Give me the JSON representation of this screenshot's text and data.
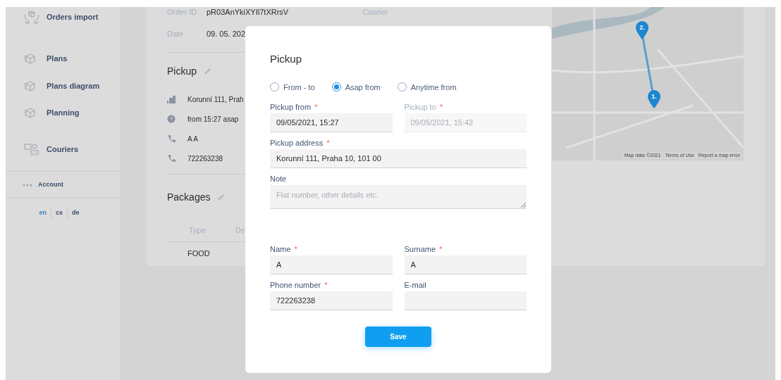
{
  "sidebar": {
    "items": [
      {
        "label": "Orders import",
        "kind": "hands"
      },
      {
        "label": "Plans",
        "kind": "box"
      },
      {
        "label": "Plans diagram",
        "kind": "box"
      },
      {
        "label": "Planning",
        "kind": "box"
      },
      {
        "label": "Couriers",
        "kind": "courier"
      }
    ],
    "account": "Account",
    "languages": [
      {
        "label": "en",
        "selected": true
      },
      {
        "label": "cs",
        "selected": false
      },
      {
        "label": "de",
        "selected": false
      }
    ]
  },
  "order": {
    "fields": [
      {
        "label": "Order ID",
        "value": "pR03AnYkiXYIl7tXRrsV"
      },
      {
        "label": "Date",
        "value": "09. 05. 202"
      }
    ],
    "courier_label": "Courier",
    "pickup": {
      "title": "Pickup",
      "lines": [
        {
          "kind": "building",
          "text": "Korunní 111, Prah"
        },
        {
          "kind": "clock",
          "text": "from 15:27 asap"
        },
        {
          "kind": "phone",
          "text": "A A"
        },
        {
          "kind": "phone",
          "text": "722263238"
        }
      ]
    },
    "packages": {
      "title": "Packages",
      "columns": [
        "Type",
        "De"
      ],
      "rows": [
        [
          "FOOD"
        ]
      ]
    }
  },
  "map": {
    "markers": [
      {
        "label": "2."
      },
      {
        "label": "1."
      }
    ],
    "footer": [
      "Map data ©2021",
      "Terms of Use",
      "Report a map error"
    ]
  },
  "modal": {
    "title": "Pickup",
    "radios": [
      {
        "label": "From - to",
        "selected": false
      },
      {
        "label": "Asap from",
        "selected": true
      },
      {
        "label": "Anytime from",
        "selected": false
      }
    ],
    "rows": [
      [
        {
          "label": "Pickup from",
          "mark": "*",
          "disabled": false,
          "value": "09/05/2021, 15:27"
        },
        {
          "label": "Pickup to",
          "mark": "*",
          "disabled": true,
          "value": "09/05/2021, 15:42"
        }
      ],
      [
        {
          "label": "Pickup address",
          "mark": "*",
          "value": "Korunní 111, Praha 10, 101 00"
        }
      ],
      [
        {
          "label": "Note",
          "kind": "textarea",
          "placeholder": "Flat number, other details etc."
        }
      ],
      [
        {
          "label": "Name",
          "mark": "*",
          "value": "A"
        },
        {
          "label": "Surname",
          "mark": "*",
          "value": "A"
        }
      ],
      [
        {
          "label": "Phone number",
          "mark": "*",
          "value": "722263238"
        },
        {
          "label": "E-mail"
        }
      ]
    ],
    "save": "Save"
  }
}
